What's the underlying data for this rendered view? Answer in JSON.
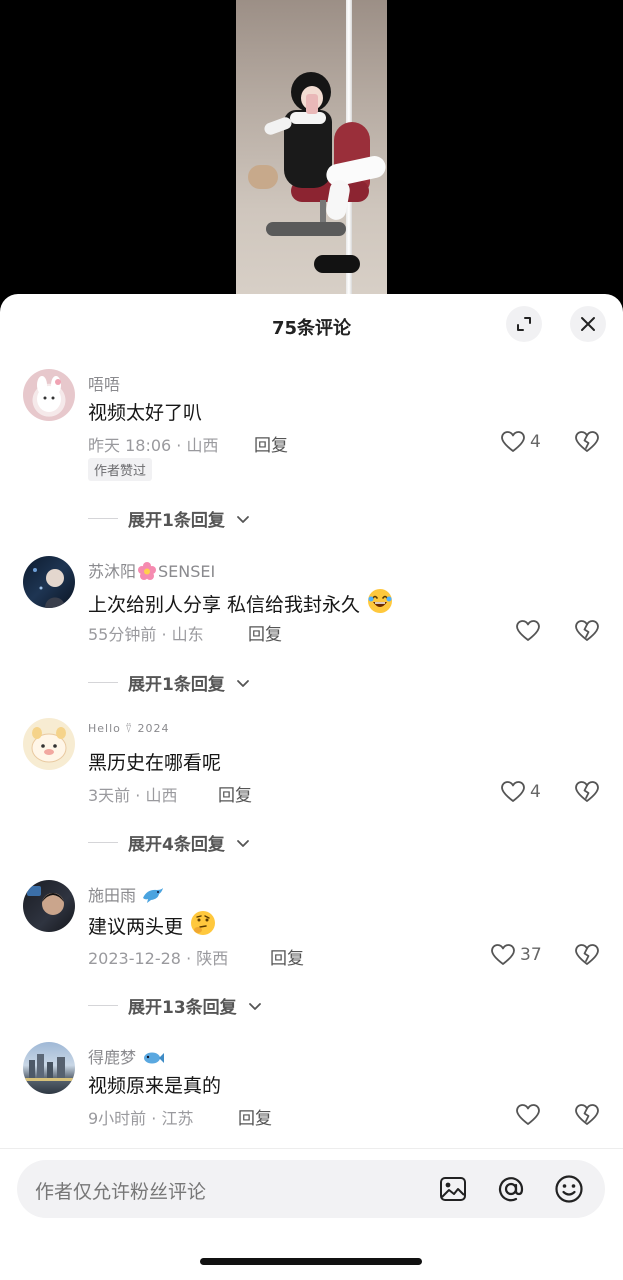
{
  "sheet": {
    "title": "75条评论"
  },
  "comments": [
    {
      "username": "唔唔",
      "text": "视频太好了叭",
      "meta": "昨天 18:06 · 山西",
      "reply_label": "回复",
      "like_count": "4",
      "badge": "作者赞过",
      "expand_label": "展开1条回复"
    },
    {
      "username": "苏沐阳",
      "username_suffix": "SENSEI",
      "text": "上次给别人分享 私信给我封永久",
      "meta": "55分钟前 · 山东",
      "reply_label": "回复",
      "like_count": "",
      "expand_label": "展开1条回复"
    },
    {
      "username": "Hello ⍢ 2024",
      "text": "黑历史在哪看呢",
      "meta": "3天前 · 山西",
      "reply_label": "回复",
      "like_count": "4",
      "expand_label": "展开4条回复"
    },
    {
      "username": "施田雨",
      "text": "建议两头更",
      "meta": "2023-12-28 · 陕西",
      "reply_label": "回复",
      "like_count": "37",
      "expand_label": "展开13条回复"
    },
    {
      "username": "得鹿梦",
      "text": "视频原来是真的",
      "meta": "9小时前 · 江苏",
      "reply_label": "回复",
      "like_count": ""
    }
  ],
  "input": {
    "placeholder": "作者仅允许粉丝评论"
  },
  "icons": {
    "expand": "expand-icon",
    "close": "close-icon",
    "like": "heart-outline-icon",
    "dislike": "broken-heart-icon",
    "chevron": "chevron-down-icon",
    "image": "image-icon",
    "mention": "at-icon",
    "emoji": "smiley-icon"
  }
}
